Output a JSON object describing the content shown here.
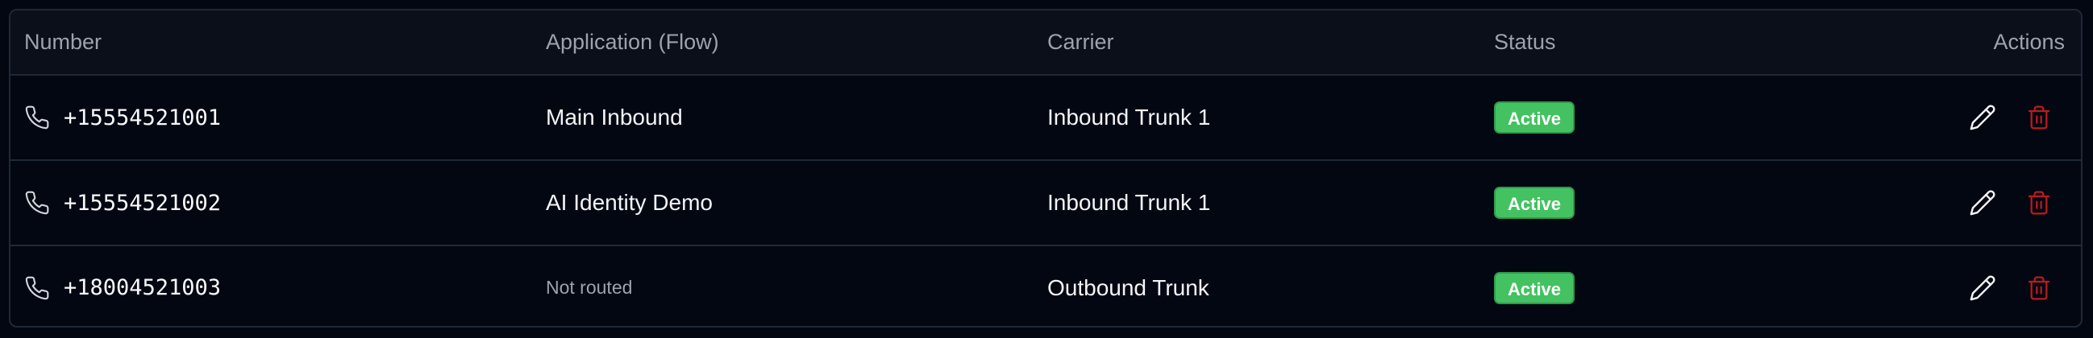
{
  "table": {
    "headers": {
      "number": "Number",
      "application": "Application (Flow)",
      "carrier": "Carrier",
      "status": "Status",
      "actions": "Actions"
    },
    "rows": [
      {
        "number": "+15554521001",
        "application": "Main Inbound",
        "application_routed": true,
        "carrier": "Inbound Trunk 1",
        "status": "Active"
      },
      {
        "number": "+15554521002",
        "application": "AI Identity Demo",
        "application_routed": true,
        "carrier": "Inbound Trunk 1",
        "status": "Active"
      },
      {
        "number": "+18004521003",
        "application": "Not routed",
        "application_routed": false,
        "carrier": "Outbound Trunk",
        "status": "Active"
      }
    ]
  },
  "icons": {
    "number": "phone-icon",
    "edit": "pencil-icon",
    "delete": "trash-icon"
  },
  "colors": {
    "background": "#030712",
    "border": "#1f2937",
    "header_text": "#9ca3af",
    "active_badge": "#44c262",
    "delete_icon": "#b91c1c"
  }
}
